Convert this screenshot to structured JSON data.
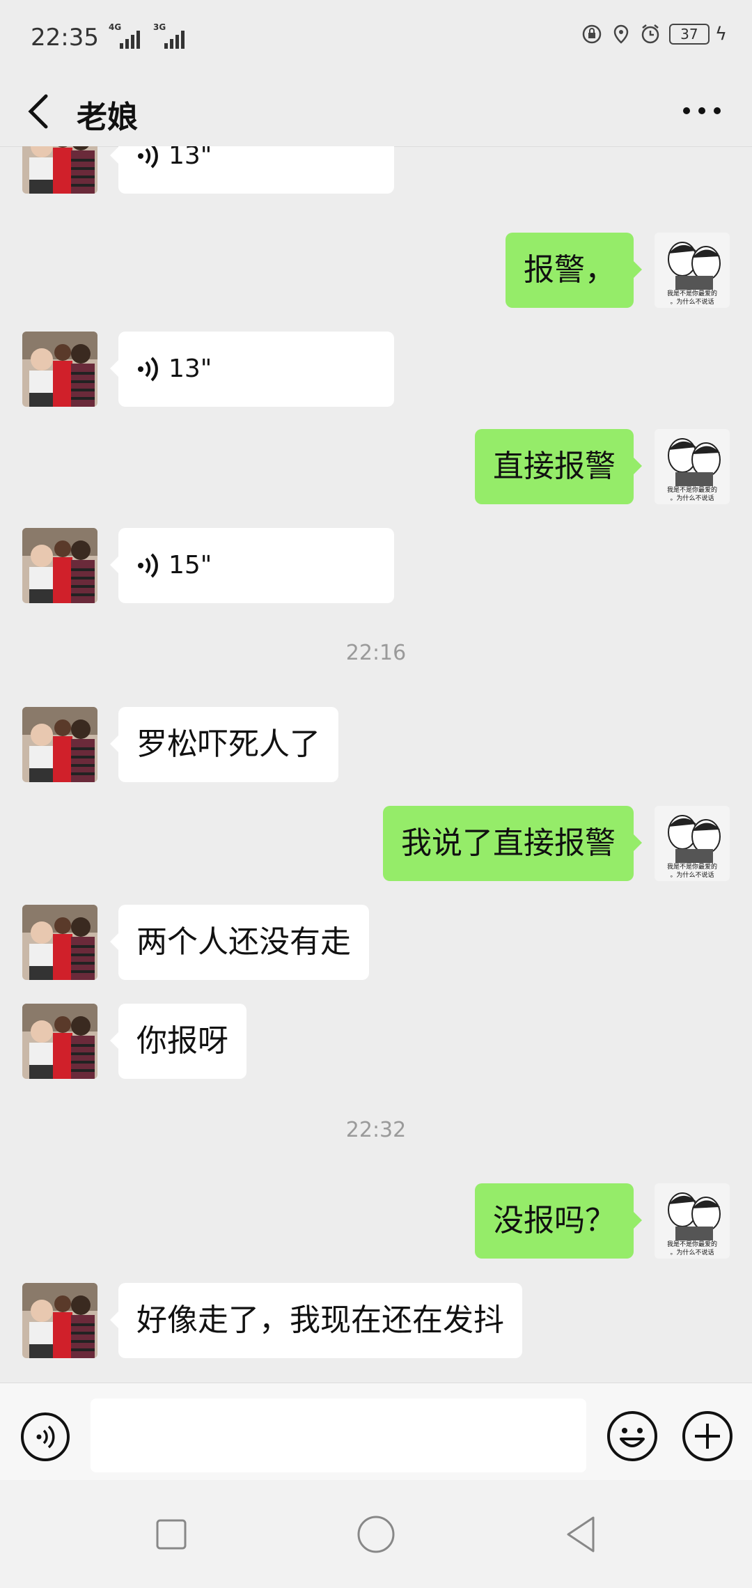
{
  "status_bar": {
    "time": "22:35",
    "signal1": "4G",
    "signal2": "3G",
    "battery": "37"
  },
  "header": {
    "title": "老娘"
  },
  "messages": [
    {
      "side": "in",
      "type": "voice",
      "text": "13\""
    },
    {
      "side": "out",
      "type": "text",
      "text": "报警，"
    },
    {
      "side": "in",
      "type": "voice",
      "text": "13\""
    },
    {
      "side": "out",
      "type": "text",
      "text": "直接报警"
    },
    {
      "side": "in",
      "type": "voice",
      "text": "15\""
    },
    {
      "type": "timestamp",
      "text": "22:16"
    },
    {
      "side": "in",
      "type": "text",
      "text": "罗松吓死人了"
    },
    {
      "side": "out",
      "type": "text",
      "text": "我说了直接报警"
    },
    {
      "side": "in",
      "type": "text",
      "text": "两个人还没有走"
    },
    {
      "side": "in",
      "type": "text",
      "text": "你报呀"
    },
    {
      "type": "timestamp",
      "text": "22:32"
    },
    {
      "side": "out",
      "type": "text",
      "text": "没报吗？"
    },
    {
      "side": "in",
      "type": "text",
      "text": "好像走了，我现在还在发抖"
    }
  ],
  "sticker_text": "我是不是你最爱的。为什么不说话",
  "colors": {
    "background": "#EDEDED",
    "outgoing_bubble": "#95EC69",
    "incoming_bubble": "#FFFFFF"
  }
}
